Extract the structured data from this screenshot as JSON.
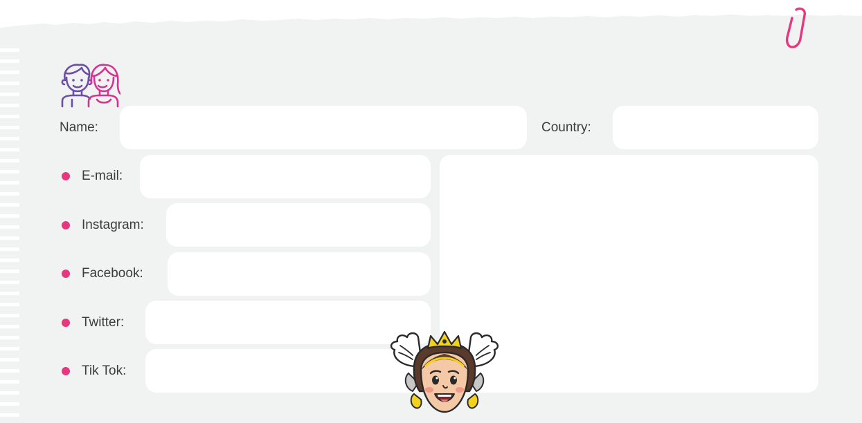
{
  "colors": {
    "paper": "#f1f2f2",
    "field": "#ffffff",
    "accent": "#e6377f",
    "purple": "#6b4ea5"
  },
  "form": {
    "name_label": "Name:",
    "country_label": "Country:",
    "name_value": "",
    "country_value": "",
    "photo_value": "",
    "contacts": [
      {
        "label": "E-mail:",
        "value": ""
      },
      {
        "label": "Instagram:",
        "value": ""
      },
      {
        "label": "Facebook:",
        "value": ""
      },
      {
        "label": "Twitter:",
        "value": ""
      },
      {
        "label": "Tik Tok:",
        "value": ""
      }
    ]
  },
  "icons": {
    "top_left": "friends-icon",
    "top_right": "paperclip-icon",
    "mascot": "mascot-girl-icon"
  }
}
